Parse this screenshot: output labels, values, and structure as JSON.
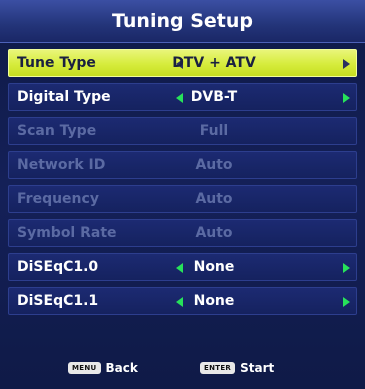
{
  "title": "Tuning Setup",
  "rows": [
    {
      "label": "Tune Type",
      "value": "DTV + ATV"
    },
    {
      "label": "Digital Type",
      "value": "DVB-T"
    },
    {
      "label": "Scan Type",
      "value": "Full"
    },
    {
      "label": "Network ID",
      "value": "Auto"
    },
    {
      "label": "Frequency",
      "value": "Auto"
    },
    {
      "label": "Symbol Rate",
      "value": "Auto"
    },
    {
      "label": "DiSEqC1.0",
      "value": "None"
    },
    {
      "label": "DiSEqC1.1",
      "value": "None"
    }
  ],
  "footer": {
    "menu_key": "MENU",
    "back_label": "Back",
    "enter_key": "ENTER",
    "start_label": "Start"
  },
  "colors": {
    "highlight": "#d6ec3c",
    "arrow": "#27e25a",
    "disabled_text": "#5b6aa3"
  }
}
